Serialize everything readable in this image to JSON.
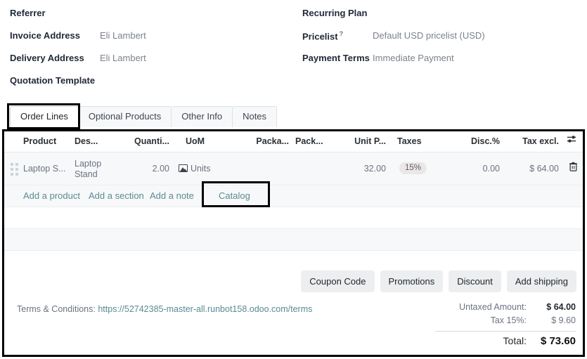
{
  "form": {
    "left": [
      {
        "label": "Referrer",
        "value": ""
      },
      {
        "label": "Invoice Address",
        "value": "Eli Lambert"
      },
      {
        "label": "Delivery Address",
        "value": "Eli Lambert"
      },
      {
        "label": "Quotation Template",
        "value": ""
      }
    ],
    "right": [
      {
        "label": "Recurring Plan",
        "value": "",
        "help": ""
      },
      {
        "label": "Pricelist",
        "value": "Default USD pricelist (USD)",
        "help": "?"
      },
      {
        "label": "Payment Terms",
        "value": "Immediate Payment",
        "help": ""
      }
    ]
  },
  "tabs": [
    {
      "label": "Order Lines",
      "active": true
    },
    {
      "label": "Optional Products",
      "active": false
    },
    {
      "label": "Other Info",
      "active": false
    },
    {
      "label": "Notes",
      "active": false
    }
  ],
  "order_lines": {
    "columns": [
      "Product",
      "Des...",
      "Quanti...",
      "UoM",
      "Packa...",
      "Pack...",
      "Unit P...",
      "Taxes",
      "Disc.%",
      "Tax excl."
    ],
    "options_icon": "sliders-icon",
    "rows": [
      {
        "drag": "drag-handle-icon",
        "product": "Laptop S...",
        "description": "Laptop Stand",
        "quantity": "2.00",
        "uom_icon": "image-placeholder-icon",
        "uom": "Units",
        "packaging_qty": "",
        "packaging": "",
        "unit_price": "32.00",
        "taxes": "15%",
        "discount": "0.00",
        "tax_excl": "$ 64.00",
        "delete_icon": "trash-icon"
      }
    ],
    "actions": [
      {
        "label": "Add a product",
        "annotated": false
      },
      {
        "label": "Add a section",
        "annotated": false
      },
      {
        "label": "Add a note",
        "annotated": false
      },
      {
        "label": "Catalog",
        "annotated": true
      }
    ]
  },
  "buttons": [
    {
      "label": "Coupon Code"
    },
    {
      "label": "Promotions"
    },
    {
      "label": "Discount"
    },
    {
      "label": "Add shipping"
    }
  ],
  "terms": {
    "label": "Terms & Conditions:",
    "url": "https://52742385-master-all.runbot158.odoo.com/terms"
  },
  "totals": [
    {
      "label": "Untaxed Amount:",
      "value": "$ 64.00"
    },
    {
      "label": "Tax 15%:",
      "value": "$ 9.60"
    },
    {
      "label": "Total:",
      "value": "$ 73.60"
    }
  ],
  "colors": {
    "link": "#5b8a93",
    "annotation": "#000000",
    "row_bg": "#f7f8f9",
    "badge_bg": "#ece7e7"
  }
}
